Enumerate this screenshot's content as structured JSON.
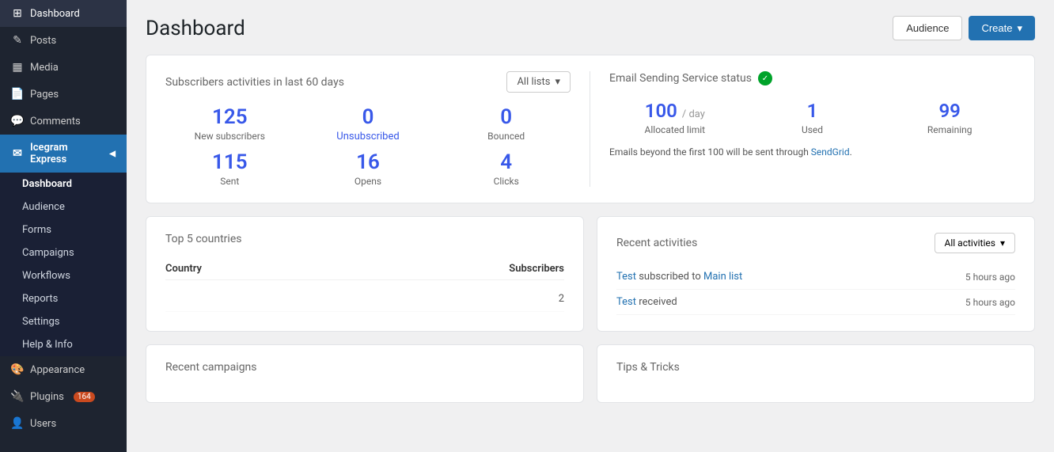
{
  "sidebar": {
    "items": [
      {
        "label": "Dashboard",
        "icon": "⊞",
        "name": "dashboard"
      },
      {
        "label": "Posts",
        "icon": "✎",
        "name": "posts"
      },
      {
        "label": "Media",
        "icon": "🎞",
        "name": "media"
      },
      {
        "label": "Pages",
        "icon": "📄",
        "name": "pages"
      },
      {
        "label": "Comments",
        "icon": "💬",
        "name": "comments"
      },
      {
        "label": "Icegram Express",
        "icon": "✉",
        "name": "icegram-express",
        "arrow": "◀"
      },
      {
        "label": "Dashboard",
        "icon": "",
        "name": "icegram-dashboard"
      },
      {
        "label": "Audience",
        "icon": "",
        "name": "icegram-audience"
      },
      {
        "label": "Forms",
        "icon": "",
        "name": "icegram-forms"
      },
      {
        "label": "Campaigns",
        "icon": "",
        "name": "icegram-campaigns"
      },
      {
        "label": "Workflows",
        "icon": "",
        "name": "icegram-workflows"
      },
      {
        "label": "Reports",
        "icon": "",
        "name": "icegram-reports"
      },
      {
        "label": "Settings",
        "icon": "",
        "name": "icegram-settings"
      },
      {
        "label": "Help & Info",
        "icon": "",
        "name": "icegram-help"
      },
      {
        "label": "Appearance",
        "icon": "🎨",
        "name": "appearance"
      },
      {
        "label": "Plugins",
        "icon": "🔌",
        "name": "plugins",
        "badge": "164"
      },
      {
        "label": "Users",
        "icon": "👤",
        "name": "users"
      }
    ]
  },
  "header": {
    "title": "Dashboard",
    "audience_btn": "Audience",
    "create_btn": "Create",
    "create_arrow": "▾"
  },
  "subscribers_card": {
    "title": "Subscribers activities in last 60 days",
    "dropdown_label": "All lists",
    "stats": [
      {
        "number": "125",
        "label": "New subscribers"
      },
      {
        "number": "0",
        "label": "Unsubscribed",
        "style": "unsubscribed"
      },
      {
        "number": "0",
        "label": "Bounced"
      },
      {
        "number": "115",
        "label": "Sent"
      },
      {
        "number": "16",
        "label": "Opens"
      },
      {
        "number": "4",
        "label": "Clicks"
      }
    ]
  },
  "email_status_card": {
    "title": "Email Sending Service status",
    "stats": [
      {
        "number": "100",
        "unit": "/ day",
        "label": "Allocated limit"
      },
      {
        "number": "1",
        "unit": "",
        "label": "Used"
      },
      {
        "number": "99",
        "unit": "",
        "label": "Remaining"
      }
    ],
    "note_prefix": "Emails beyond the first 100 will be sent through ",
    "note_link": "SendGrid",
    "note_suffix": "."
  },
  "countries": {
    "title": "Top 5 countries",
    "col_country": "Country",
    "col_subscribers": "Subscribers",
    "rows": [
      {
        "country": "",
        "subscribers": "2"
      }
    ]
  },
  "activities": {
    "title": "Recent activities",
    "dropdown_label": "All activities",
    "rows": [
      {
        "text_prefix": "",
        "link1": "Test",
        "text_mid": " subscribed to ",
        "link2": "Main list",
        "text_suffix": "",
        "time": "5 hours ago"
      },
      {
        "text_prefix": "",
        "link1": "Test",
        "text_mid": " received",
        "link2": "",
        "text_suffix": "",
        "time": "5 hours ago"
      }
    ]
  },
  "recent_campaigns": {
    "title": "Recent campaigns"
  },
  "tips": {
    "title": "Tips & Tricks"
  }
}
